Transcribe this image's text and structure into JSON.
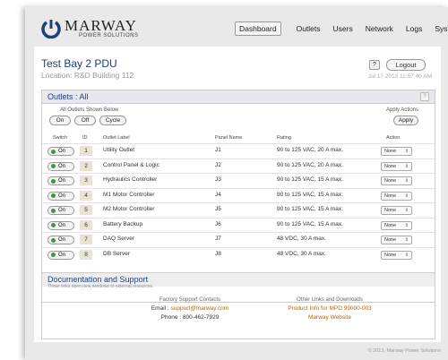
{
  "brand": {
    "name": "MARWAY",
    "tagline": "POWER SOLUTIONS",
    "colors": {
      "accent": "#1f3f7a",
      "on_indicator": "#3a9a3a",
      "link": "#b26a00"
    }
  },
  "nav": [
    "Dashboard",
    "Outlets",
    "Users",
    "Network",
    "Logs",
    "System"
  ],
  "header": {
    "title": "Test Bay 2 PDU",
    "location": "Location: R&D Building 112",
    "help_label": "?",
    "logout_label": "Logout",
    "timestamp": "Jul 17 2013 11:57:40 AM"
  },
  "outlets": {
    "title": "Outlets : All",
    "help_label": "?",
    "shown_label": "All Outlets Shown Below",
    "bulk_buttons": [
      "On",
      "Off",
      "Cycle"
    ],
    "apply_label": "Apply Actions",
    "apply_button": "Apply",
    "columns": {
      "switch": "Switch",
      "id": "ID",
      "label": "Outlet Label",
      "panel": "Panel Name",
      "rating": "Rating",
      "action": "Action"
    },
    "rows": [
      {
        "state": "On",
        "id": "1",
        "label": "Utility Outlet",
        "panel": "J1",
        "rating": "90 to 125 VAC, 20 A max.",
        "action": "None"
      },
      {
        "state": "On",
        "id": "2",
        "label": "Control Panel & Logic",
        "panel": "J2",
        "rating": "90 to 125 VAC, 20 A max.",
        "action": "None"
      },
      {
        "state": "On",
        "id": "3",
        "label": "Hydraulics Controller",
        "panel": "J3",
        "rating": "90 to 125 VAC, 15 A max.",
        "action": "None"
      },
      {
        "state": "On",
        "id": "4",
        "label": "M1 Motor Controller",
        "panel": "J4",
        "rating": "90 to 125 VAC, 15 A max.",
        "action": "None"
      },
      {
        "state": "On",
        "id": "5",
        "label": "M2 Motor Controller",
        "panel": "J5",
        "rating": "90 to 125 VAC, 15 A max.",
        "action": "None"
      },
      {
        "state": "On",
        "id": "6",
        "label": "Battery Backup",
        "panel": "J6",
        "rating": "90 to 125 VAC, 15 A max.",
        "action": "None"
      },
      {
        "state": "On",
        "id": "7",
        "label": "DAQ Server",
        "panel": "J7",
        "rating": "48 VDC, 30 A max.",
        "action": "None"
      },
      {
        "state": "On",
        "id": "8",
        "label": "DB Server",
        "panel": "J8",
        "rating": "48 VDC, 30 A max.",
        "action": "None"
      }
    ]
  },
  "docs": {
    "title": "Documentation and Support",
    "subtitle": "These links open new windows to external resources.",
    "factory_title": "Factory Support Contacts",
    "email_prefix": "Email : ",
    "email": "support@marway.com",
    "phone": "Phone : 800-462-7929",
    "other_title": "Other Links and Downloads",
    "product_link": "Product Info for MPD 99000-003",
    "website_link": "Marway Website"
  },
  "footer": "© 2013, Marway Power Solutions"
}
